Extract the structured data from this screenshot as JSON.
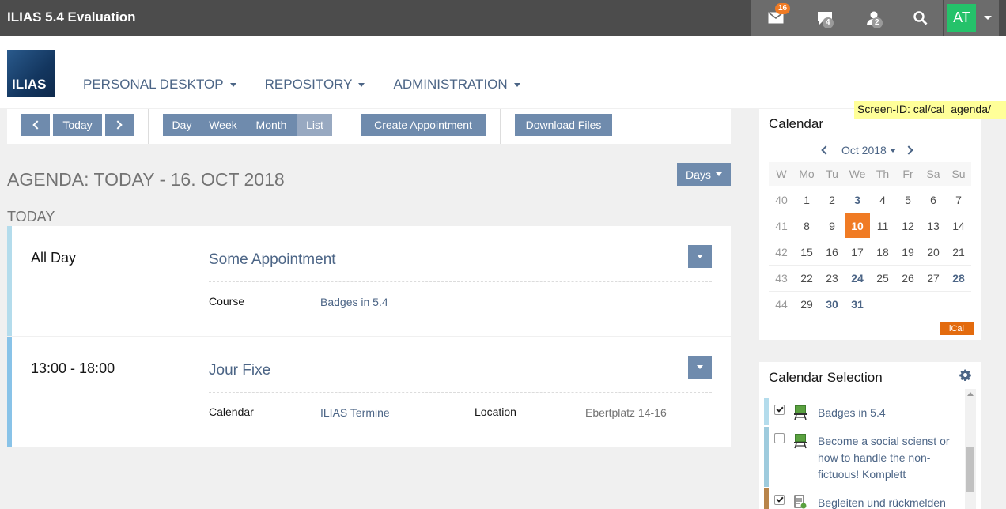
{
  "topbar": {
    "title": "ILIAS 5.4 Evaluation",
    "mail_count": "16",
    "chat_count": "4",
    "contacts_count": "2",
    "user_initials": "AT"
  },
  "header": {
    "logo_text": "ILIAS",
    "nav": [
      "PERSONAL DESKTOP",
      "REPOSITORY",
      "ADMINISTRATION"
    ],
    "screen_id": "Screen-ID: cal/cal_agenda/"
  },
  "toolbar": {
    "today": "Today",
    "views": [
      "Day",
      "Week",
      "Month",
      "List"
    ],
    "create": "Create Appointment",
    "download": "Download Files"
  },
  "agenda": {
    "title": "AGENDA: TODAY - 16. OCT 2018",
    "days_button": "Days",
    "section": "TODAY",
    "events": [
      {
        "time": "All Day",
        "title": "Some Appointment",
        "props": [
          {
            "key": "Course",
            "value": "Badges in 5.4"
          }
        ]
      },
      {
        "time": "13:00 - 18:00",
        "title": "Jour Fixe",
        "props": [
          {
            "key": "Calendar",
            "value": "ILIAS Termine"
          },
          {
            "key": "Location",
            "value": "Ebertplatz 14-16"
          }
        ]
      }
    ]
  },
  "calendar": {
    "heading": "Calendar",
    "month": "Oct 2018",
    "weekday_headers": [
      "W",
      "Mo",
      "Tu",
      "We",
      "Th",
      "Fr",
      "Sa",
      "Su"
    ],
    "weeks": [
      {
        "wk": "40",
        "days": [
          "1",
          "2",
          "3",
          "4",
          "5",
          "6",
          "7"
        ]
      },
      {
        "wk": "41",
        "days": [
          "8",
          "9",
          "10",
          "11",
          "12",
          "13",
          "14"
        ]
      },
      {
        "wk": "42",
        "days": [
          "15",
          "16",
          "17",
          "18",
          "19",
          "20",
          "21"
        ]
      },
      {
        "wk": "43",
        "days": [
          "22",
          "23",
          "24",
          "25",
          "26",
          "27",
          "28"
        ]
      },
      {
        "wk": "44",
        "days": [
          "29",
          "30",
          "31",
          "",
          "",
          "",
          ""
        ]
      }
    ],
    "ical": "iCal",
    "colors": {
      "today": "#f07b24",
      "accent": "#6f8bad",
      "ical": "#e36b0e"
    }
  },
  "selection": {
    "heading": "Calendar Selection",
    "items": [
      {
        "label": "Badges in 5.4",
        "checked": true,
        "color": "#b4dcec",
        "icon": "course-icon"
      },
      {
        "label": "Become a social scienst or how to handle the non-fictuous! Komplett",
        "checked": false,
        "color": "#9ecbdd",
        "icon": "course-icon"
      },
      {
        "label": "Begleiten und rückmelden",
        "checked": true,
        "color": "#b8844a",
        "icon": "survey-icon"
      }
    ]
  }
}
